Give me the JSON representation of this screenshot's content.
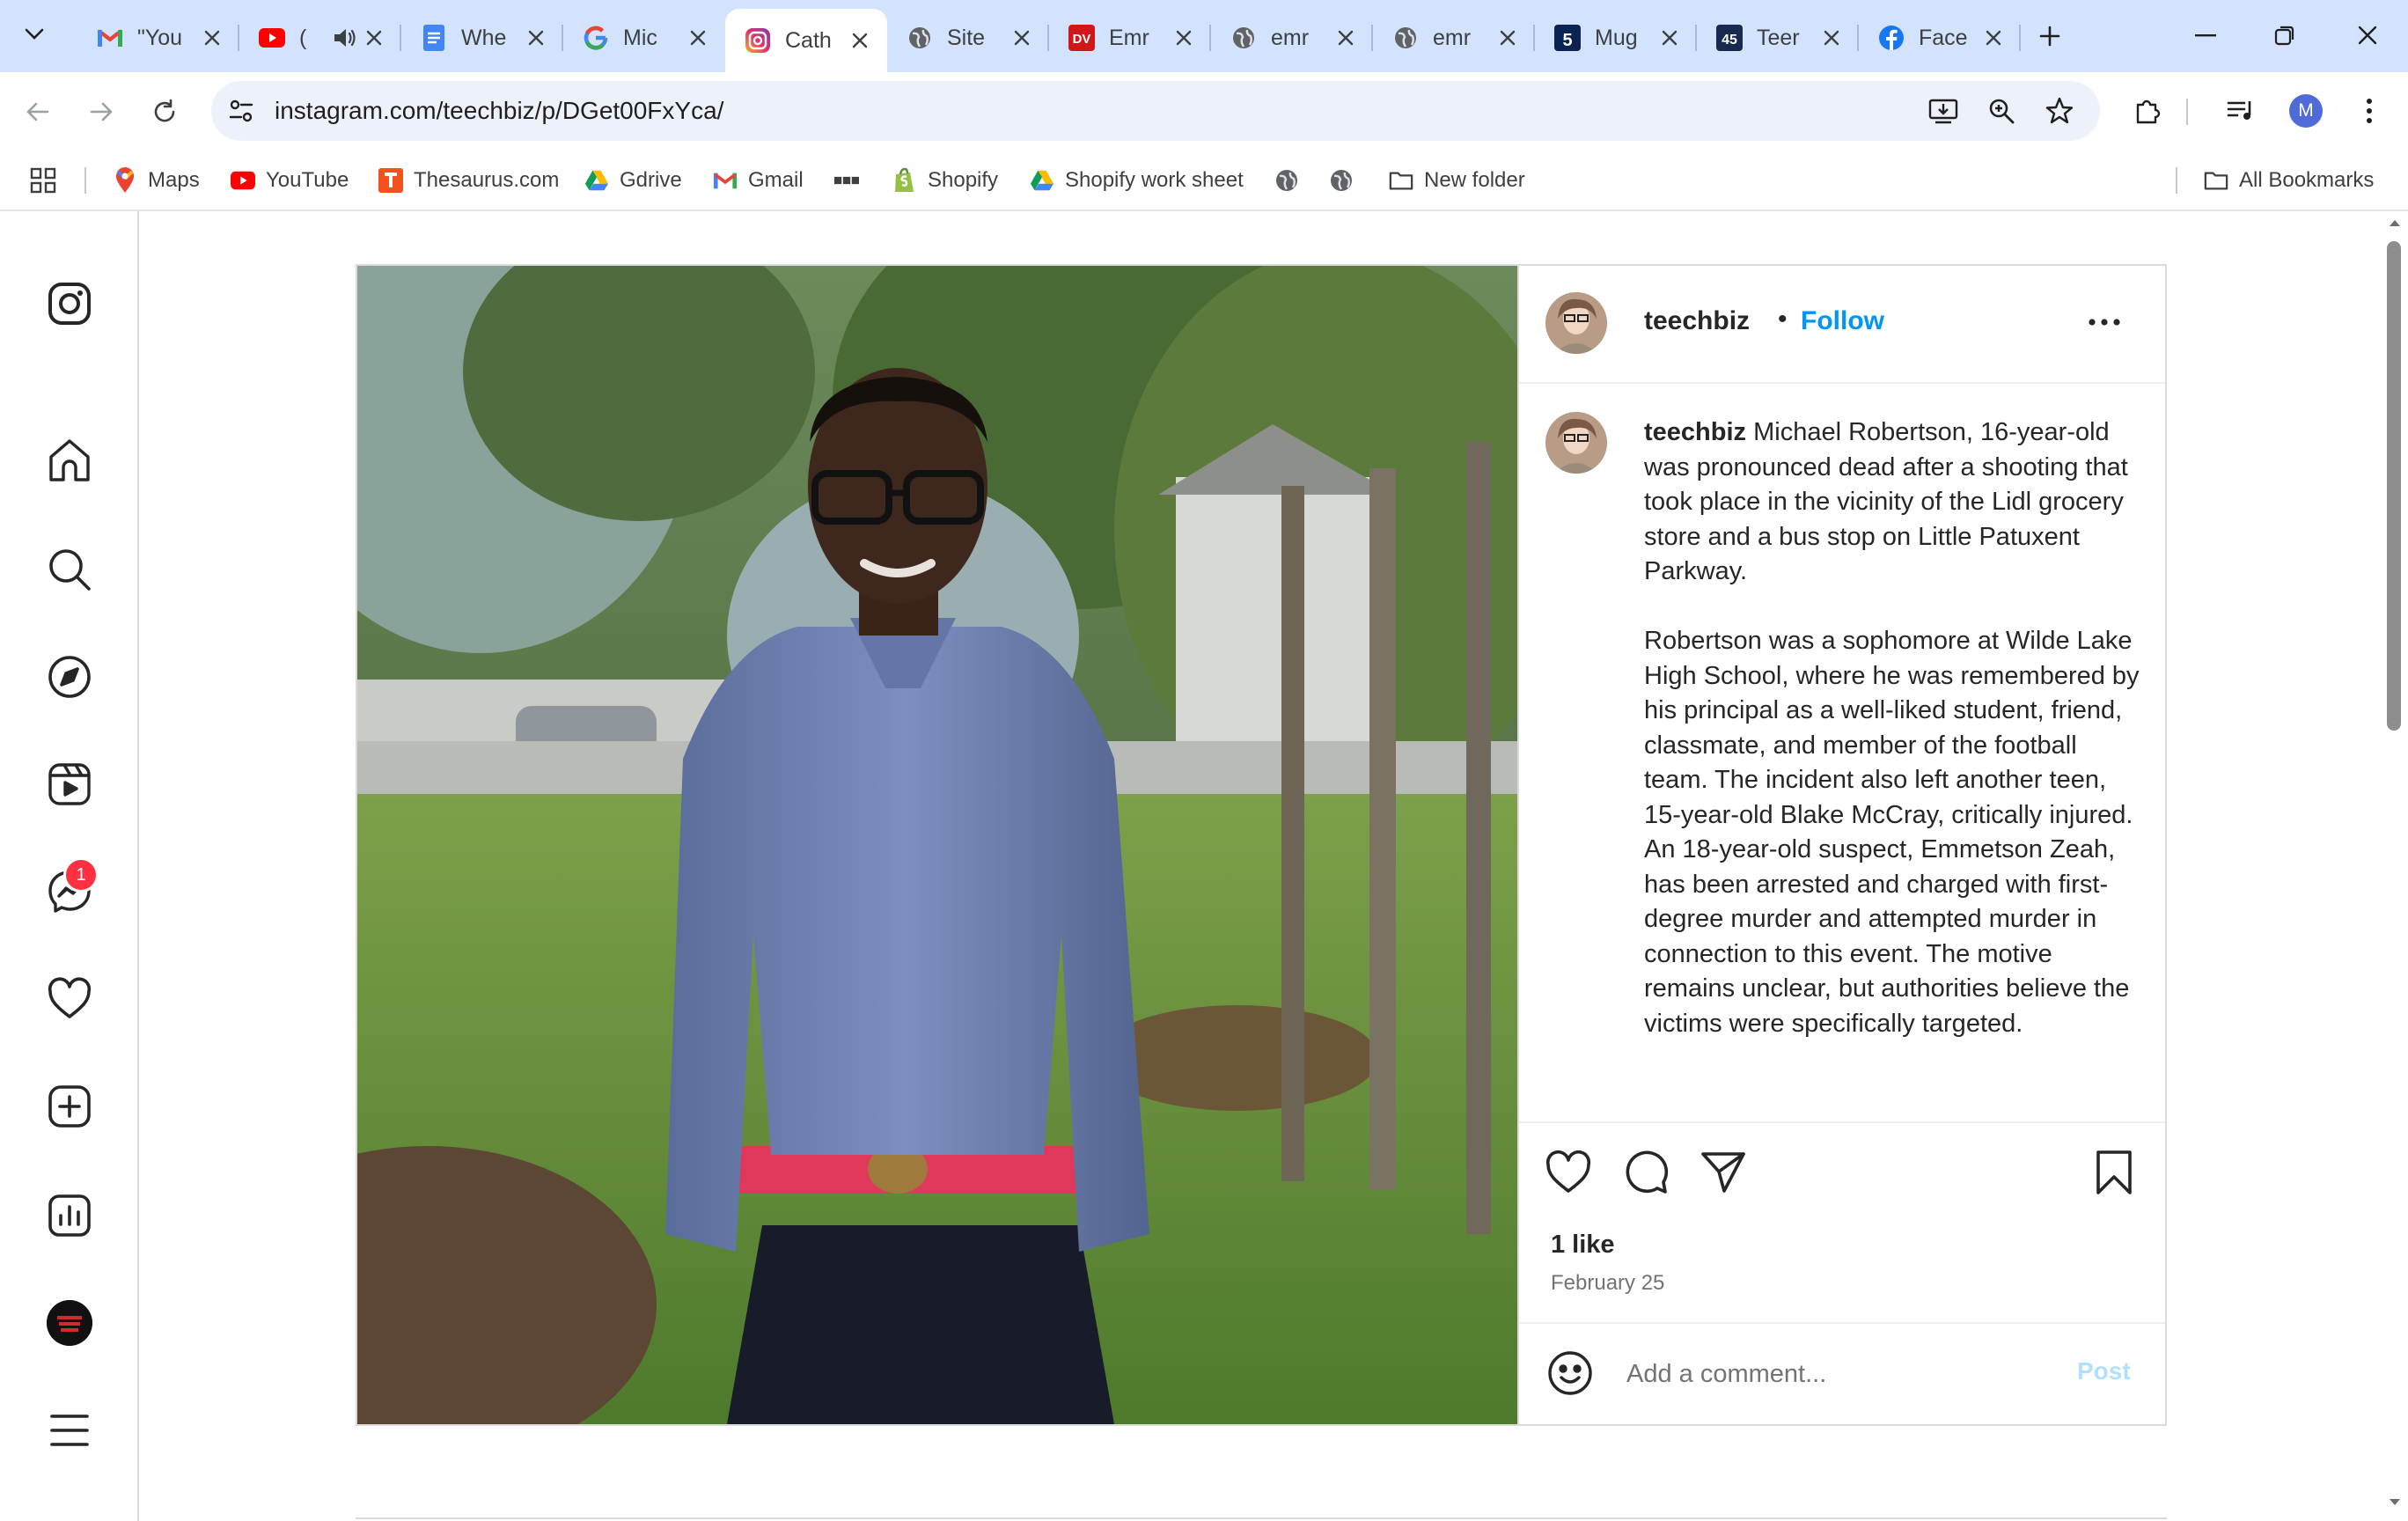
{
  "browser": {
    "tabs": [
      {
        "title": "\"You",
        "favicon": "gmail-icon",
        "has_audio": false
      },
      {
        "title": "(",
        "favicon": "youtube-icon",
        "has_audio": true
      },
      {
        "title": "Whe",
        "favicon": "docs-icon",
        "has_audio": false
      },
      {
        "title": "Mic",
        "favicon": "google-icon",
        "has_audio": false
      },
      {
        "title": "Cath",
        "favicon": "instagram-icon",
        "has_audio": false,
        "active": true
      },
      {
        "title": "Site",
        "favicon": "globe-icon",
        "has_audio": false
      },
      {
        "title": "Emr",
        "favicon": "dv-icon",
        "favicon_text": "DV",
        "has_audio": false
      },
      {
        "title": "emr",
        "favicon": "globe-icon",
        "has_audio": false
      },
      {
        "title": "emr",
        "favicon": "globe-icon",
        "has_audio": false
      },
      {
        "title": "Mug",
        "favicon": "fox5-icon",
        "favicon_text": "5",
        "has_audio": false
      },
      {
        "title": "Teer",
        "favicon": "channel45-icon",
        "favicon_text": "45",
        "has_audio": false
      },
      {
        "title": "Face",
        "favicon": "facebook-icon",
        "has_audio": false
      }
    ],
    "url": "instagram.com/teechbiz/p/DGet00FxYca/",
    "profile_initial": "M",
    "bookmarks": [
      {
        "label": "Maps",
        "icon": "maps-icon"
      },
      {
        "label": "YouTube",
        "icon": "youtube-icon"
      },
      {
        "label": "Thesaurus.com",
        "icon": "thesaurus-icon"
      },
      {
        "label": "Gdrive",
        "icon": "drive-icon"
      },
      {
        "label": "Gmail",
        "icon": "gmail-icon"
      },
      {
        "label": "",
        "icon": "bbc-icon"
      },
      {
        "label": "Shopify",
        "icon": "shopify-icon"
      },
      {
        "label": "Shopify work sheet",
        "icon": "drive-icon"
      },
      {
        "label": "",
        "icon": "globe-icon"
      },
      {
        "label": "",
        "icon": "globe-icon"
      },
      {
        "label": "New folder",
        "icon": "folder-icon"
      }
    ],
    "all_bookmarks_label": "All Bookmarks"
  },
  "instagram": {
    "nav": [
      "instagram-logo-icon",
      "home-icon",
      "search-icon",
      "explore-icon",
      "reels-icon",
      "messenger-icon",
      "heart-icon",
      "create-icon",
      "dashboard-icon",
      "profile-avatar",
      "menu-icon"
    ],
    "messages_badge": "1",
    "post": {
      "username": "teechbiz",
      "follow_label": "Follow",
      "caption_paragraphs": [
        "Michael Robertson, 16-year-old was pronounced dead after a shooting that took place in the vicinity of the Lidl grocery store and a bus stop on Little Patuxent Parkway.",
        "Robertson was a sophomore at Wilde Lake High School, where he was remembered by his principal as a well-liked student, friend, classmate, and member of the football team. The incident also left another teen, 15-year-old Blake McCray, critically injured. An 18-year-old suspect, Emmetson Zeah, has been arrested and charged with first-degree murder and attempted murder in connection to this event. The motive remains unclear, but authorities believe the victims were specifically targeted."
      ],
      "likes": "1 like",
      "date": "February 25",
      "comment_placeholder": "Add a comment...",
      "post_label": "Post"
    }
  },
  "colors": {
    "tabstrip_bg": "#d3e3fd",
    "omnibox_bg": "#edf2fa",
    "follow_blue": "#0095f6",
    "post_btn_disabled": "#b2dffc",
    "badge_red": "#ff3040"
  }
}
